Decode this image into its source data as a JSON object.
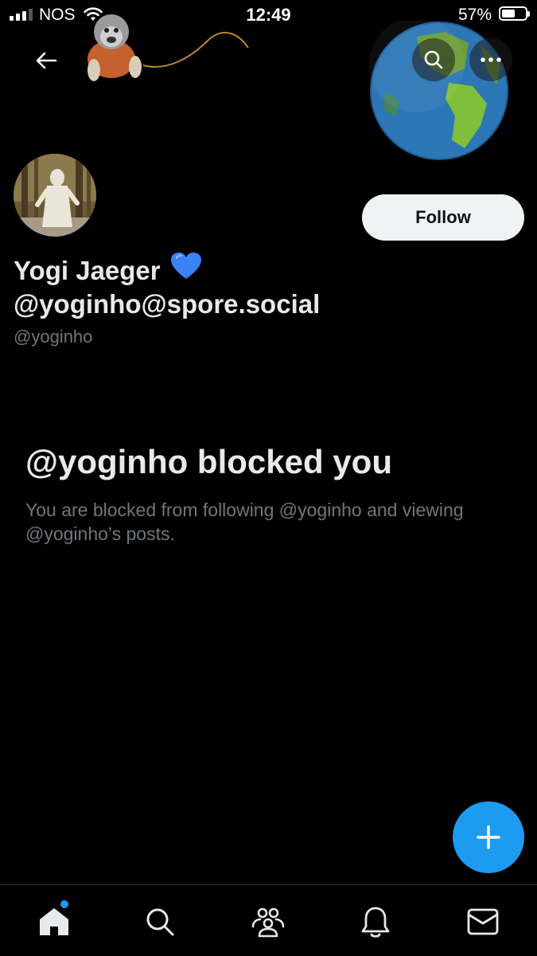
{
  "status_bar": {
    "carrier": "NOS",
    "time": "12:49",
    "battery_percent_label": "57%",
    "battery_level": 0.57
  },
  "profile": {
    "display_name": "Yogi Jaeger",
    "display_name_emoji": "blue-heart-icon",
    "display_handle": "@yoginho@spore.social",
    "username": "@yoginho",
    "follow_label": "Follow"
  },
  "blocked": {
    "title": "@yoginho blocked you",
    "description": "You are blocked from following @yoginho and viewing @yoginho’s posts."
  },
  "bottom_nav": {
    "items": [
      "home-icon",
      "search-icon",
      "communities-icon",
      "notifications-icon",
      "messages-icon"
    ],
    "active": "home",
    "home_has_badge": true
  },
  "colors": {
    "background": "#000000",
    "accent": "#1d9bf0",
    "primary_text": "#e7e9ea",
    "secondary_text": "#71767b",
    "follow_button_bg": "#eff3f4"
  }
}
